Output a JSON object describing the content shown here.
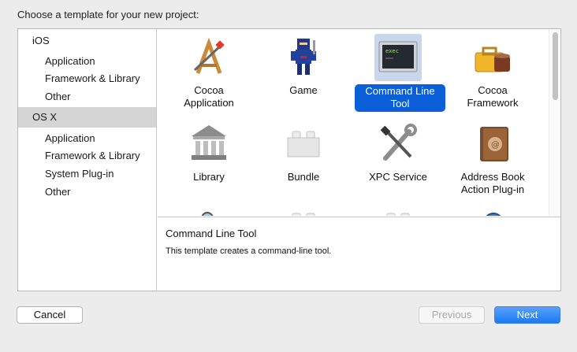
{
  "dialog": {
    "title": "Choose a template for your new project:"
  },
  "sidebar": {
    "groups": [
      {
        "label": "iOS",
        "items": [
          "Application",
          "Framework & Library",
          "Other"
        ]
      },
      {
        "label": "OS X",
        "selected": true,
        "items": [
          "Application",
          "Framework & Library",
          "System Plug-in",
          "Other"
        ]
      }
    ]
  },
  "templates": [
    {
      "label": "Cocoa\nApplication",
      "icon": "cocoa-app-icon"
    },
    {
      "label": "Game",
      "icon": "game-ninja-icon"
    },
    {
      "label": "Command Line\nTool",
      "icon": "terminal-exec-icon",
      "selected": true,
      "icon_text": "exec"
    },
    {
      "label": "Cocoa\nFramework",
      "icon": "toolbox-coffee-icon"
    },
    {
      "label": "Library",
      "icon": "library-building-icon"
    },
    {
      "label": "Bundle",
      "icon": "lego-brick-icon"
    },
    {
      "label": "XPC Service",
      "icon": "wrench-screwdriver-icon"
    },
    {
      "label": "Address Book\nAction Plug-in",
      "icon": "address-book-icon"
    }
  ],
  "description": {
    "title": "Command Line Tool",
    "text": "This template creates a command-line tool."
  },
  "buttons": {
    "cancel": "Cancel",
    "previous": "Previous",
    "next": "Next"
  },
  "colors": {
    "accent": "#0b5fd8",
    "selection_bg": "#c9d7ec",
    "sidebar_selected": "#d5d5d5"
  }
}
